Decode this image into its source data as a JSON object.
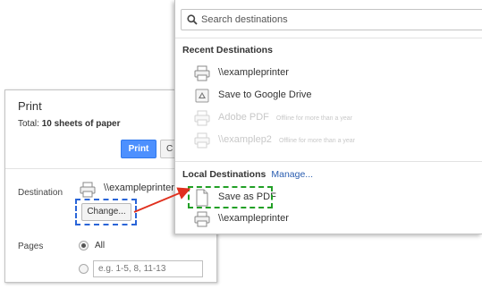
{
  "print_panel": {
    "title": "Print",
    "total_prefix": "Total: ",
    "total_value": "10 sheets of paper",
    "print_button": "Print",
    "cancel_button": "C",
    "destination_label": "Destination",
    "destination_printer": "\\\\exampleprinter",
    "change_button": "Change...",
    "pages_label": "Pages",
    "pages_all_label": "All",
    "pages_all_selected": true,
    "pages_range_placeholder": "e.g. 1-5, 8, 11-13"
  },
  "destinations": {
    "search_placeholder": "Search destinations",
    "recent_title": "Recent Destinations",
    "recent": [
      {
        "name": "\\\\exampleprinter",
        "icon": "printer-icon",
        "disabled": false,
        "note": ""
      },
      {
        "name": "Save to Google Drive",
        "icon": "google-drive-icon",
        "disabled": false,
        "note": ""
      },
      {
        "name": "Adobe PDF",
        "icon": "printer-icon",
        "disabled": true,
        "note": "Offline for more than a year"
      },
      {
        "name": "\\\\examplep2",
        "icon": "printer-icon",
        "disabled": true,
        "note": "Offline for more than a year"
      }
    ],
    "local_title": "Local Destinations",
    "manage_link": "Manage...",
    "local": [
      {
        "name": "Save as PDF",
        "icon": "pdf-document-icon",
        "disabled": false,
        "note": ""
      },
      {
        "name": "\\\\exampleprinter",
        "icon": "printer-icon",
        "disabled": false,
        "note": ""
      }
    ]
  },
  "colors": {
    "print_button": "#4d90fe",
    "change_highlight": "#2a65d8",
    "save_pdf_highlight": "#22a026",
    "arrow": "#e0301e",
    "link": "#2a5db0"
  }
}
